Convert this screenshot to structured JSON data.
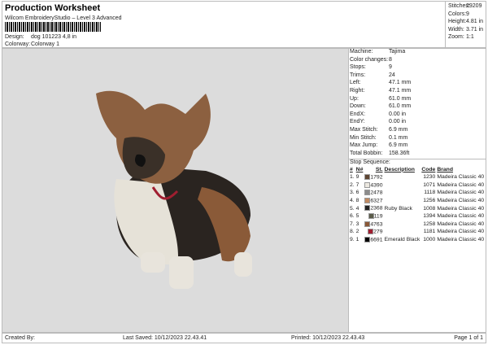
{
  "header": {
    "title": "Production Worksheet",
    "subtitle": "Wilcom EmbroideryStudio – Level 3 Advanced",
    "design_label": "Design:",
    "design_value": "dog 101223 4,8 in",
    "colorway_label": "Colorway:",
    "colorway_value": "Colorway 1"
  },
  "stats": [
    {
      "label": "Stitches:",
      "value": "29209"
    },
    {
      "label": "Colors:",
      "value": "9"
    },
    {
      "label": "Height:",
      "value": "4.81 in"
    },
    {
      "label": "Width:",
      "value": "3.71 in"
    },
    {
      "label": "Zoom:",
      "value": "1:1"
    }
  ],
  "details": [
    {
      "label": "Machine:",
      "value": "Tajima"
    },
    {
      "label": "Color changes:",
      "value": "8"
    },
    {
      "label": "Stops:",
      "value": "9"
    },
    {
      "label": "Trims:",
      "value": "24"
    },
    {
      "label": "Left:",
      "value": "47.1 mm"
    },
    {
      "label": "Right:",
      "value": "47.1 mm"
    },
    {
      "label": "Up:",
      "value": "61.0 mm"
    },
    {
      "label": "Down:",
      "value": "61.0 mm"
    },
    {
      "label": "EndX:",
      "value": "0.00 in"
    },
    {
      "label": "EndY:",
      "value": "0.00 in"
    },
    {
      "label": "Max Stitch:",
      "value": "6.9 mm"
    },
    {
      "label": "Min Stitch:",
      "value": "0.1 mm"
    },
    {
      "label": "Max Jump:",
      "value": "6.9 mm"
    },
    {
      "label": "Total Bobbin:",
      "value": "158.36ft"
    }
  ],
  "stop_sequence": {
    "title": "Stop Sequence:",
    "columns": [
      "#",
      "N#",
      "St.",
      "Description",
      "Code",
      "Brand"
    ],
    "rows": [
      {
        "idx": "1.",
        "n": "9",
        "color": "#5e4532",
        "st": "1792",
        "desc": "",
        "code": "1230",
        "brand": "Madeira Classic 40"
      },
      {
        "idx": "2.",
        "n": "7",
        "color": "#ece8e0",
        "st": "4390",
        "desc": "",
        "code": "1071",
        "brand": "Madeira Classic 40"
      },
      {
        "idx": "3.",
        "n": "6",
        "color": "#8c8c8c",
        "st": "2478",
        "desc": "",
        "code": "1118",
        "brand": "Madeira Classic 40"
      },
      {
        "idx": "4.",
        "n": "8",
        "color": "#c08a62",
        "st": "6327",
        "desc": "",
        "code": "1256",
        "brand": "Madeira Classic 40"
      },
      {
        "idx": "5.",
        "n": "4",
        "color": "#222222",
        "st": "2368",
        "desc": "Ruby Black",
        "code": "1008",
        "brand": "Madeira Classic 40"
      },
      {
        "idx": "6.",
        "n": "5",
        "color": "#5b5c4a",
        "st": "119",
        "desc": "",
        "code": "1394",
        "brand": "Madeira Classic 40"
      },
      {
        "idx": "7.",
        "n": "3",
        "color": "#8a5838",
        "st": "4763",
        "desc": "",
        "code": "1258",
        "brand": "Madeira Classic 40"
      },
      {
        "idx": "8.",
        "n": "2",
        "color": "#a01e30",
        "st": "279",
        "desc": "",
        "code": "1181",
        "brand": "Madeira Classic 40"
      },
      {
        "idx": "9.",
        "n": "1",
        "color": "#050505",
        "st": "6691",
        "desc": "Emerald Black",
        "code": "1000",
        "brand": "Madeira Classic 40"
      }
    ]
  },
  "footer": {
    "created_by": "Created By:",
    "last_saved": "Last Saved: 10/12/2023 22.43.41",
    "printed": "Printed: 10/12/2023 22.43.43",
    "page": "Page 1 of 1"
  }
}
